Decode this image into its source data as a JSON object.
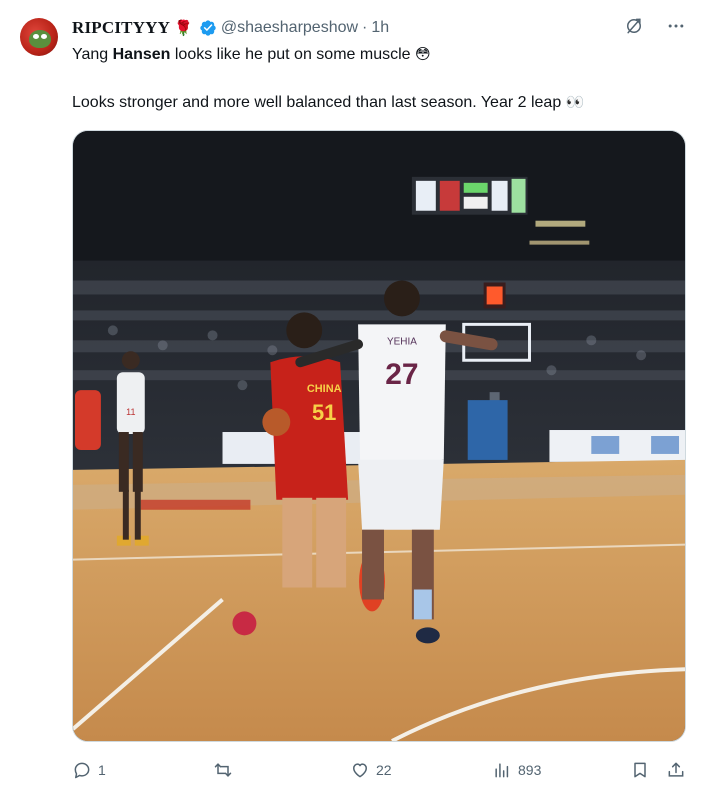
{
  "tweet": {
    "author": {
      "display_name": "RIPCITYYY",
      "name_emoji": "🌹",
      "verified": true,
      "handle": "@shaesharpeshow",
      "separator": "·",
      "time": "1h"
    },
    "text": {
      "line1_before": "Yang ",
      "line1_bold": "Hansen",
      "line1_after": " looks like he put on some muscle ",
      "line1_emoji": "😳",
      "line2": "Looks stronger and more well balanced than last season. Year 2 leap ",
      "line2_emoji": "👀"
    },
    "media": {
      "type": "image",
      "jersey_red_number": "51",
      "jersey_red_text": "CHINA",
      "jersey_white_number": "27",
      "jersey_white_name": "YEHIA",
      "jersey_left_number": "11"
    },
    "stats": {
      "replies": "1",
      "retweets": "",
      "likes": "22",
      "views": "893"
    },
    "icons": {
      "grok": "grok-icon",
      "more": "more-icon",
      "reply": "reply-icon",
      "retweet": "retweet-icon",
      "like": "like-icon",
      "views": "views-icon",
      "bookmark": "bookmark-icon",
      "share": "share-icon"
    },
    "colors": {
      "verified": "#1d9bf0",
      "text_secondary": "#536471",
      "text_primary": "#0f1419"
    }
  }
}
